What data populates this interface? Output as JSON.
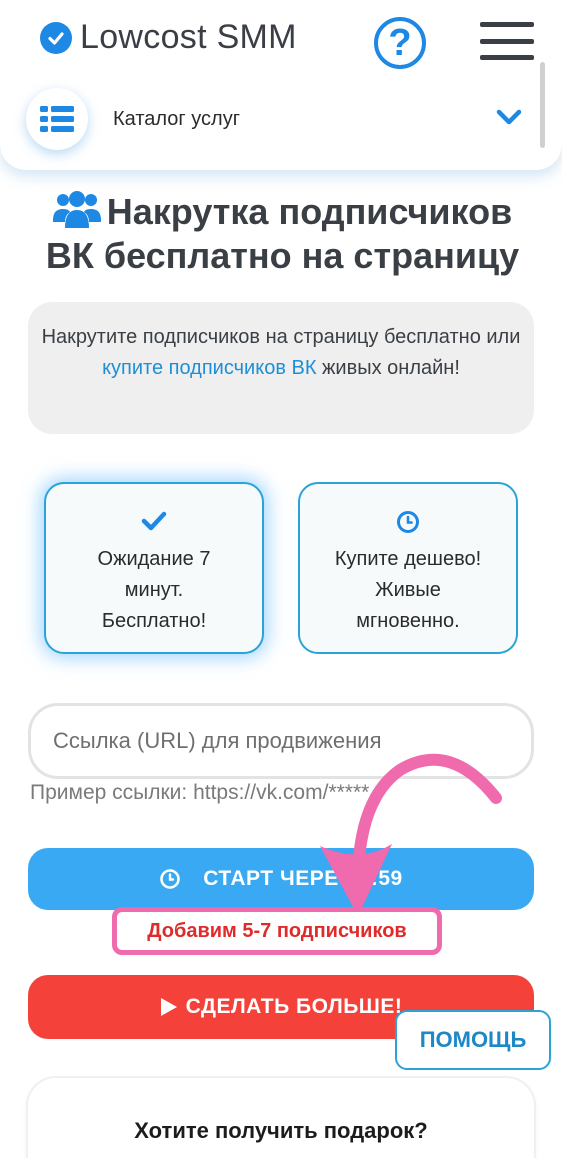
{
  "header": {
    "logo_text": "Lowcost SMM",
    "help_symbol": "?",
    "catalog_label": "Каталог услуг"
  },
  "title": "Накрутка подписчиков ВК бесплатно на страницу",
  "info": {
    "text_before": "Накрутите подписчиков на страницу бесплатно или ",
    "link": "купите подписчиков ВК",
    "text_after": " живых онлайн!"
  },
  "options": [
    {
      "line1": "Ожидание 7",
      "line2": "минут.",
      "line3": "Бесплатно!",
      "icon": "check-icon",
      "active": true
    },
    {
      "line1": "Купите дешево!",
      "line2": "Живые",
      "line3": "мгновенно.",
      "icon": "clock-icon",
      "active": false
    }
  ],
  "url_input": {
    "placeholder": "Ссылка (URL) для продвижения",
    "value": ""
  },
  "example": "Пример ссылки: https://vk.com/*****",
  "start_button": "СТАРТ ЧЕРЕЗ 0:59",
  "promo": "Добавим 5-7 подписчиков",
  "more_button": "СДЕЛАТЬ БОЛЬШЕ!",
  "help_button": "ПОМОЩЬ",
  "gift": "Хотите получить подарок?",
  "colors": {
    "primary": "#1e88e5",
    "start": "#38a9f2",
    "more": "#f4413a",
    "promo_border": "#f06aae",
    "promo_text": "#e02b2b"
  }
}
